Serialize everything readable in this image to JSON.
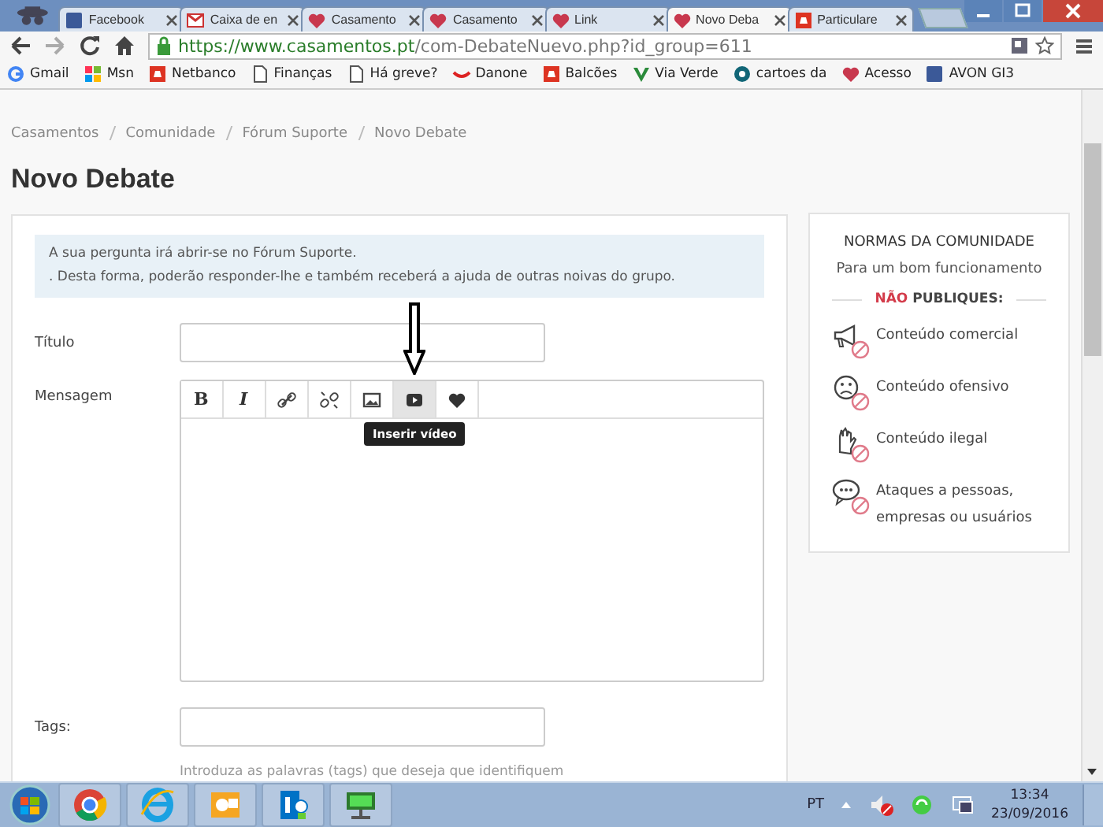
{
  "browser": {
    "tabs": [
      {
        "label": "Facebook",
        "selected": false
      },
      {
        "label": "Caixa de en",
        "selected": false
      },
      {
        "label": "Casamento",
        "selected": false
      },
      {
        "label": "Casamento",
        "selected": false
      },
      {
        "label": "Link",
        "selected": false
      },
      {
        "label": "Novo Deba",
        "selected": true
      },
      {
        "label": "Particulare",
        "selected": false
      }
    ],
    "url_host": "https://www.casamentos.pt",
    "url_path": "/com-DebateNuevo.php?id_group=611",
    "bookmarks": [
      "Gmail",
      "Msn",
      "Netbanco",
      "Finanças",
      "Há greve?",
      "Danone",
      "Balcões",
      "Via Verde",
      "cartoes da",
      "Acesso",
      "AVON GI3"
    ]
  },
  "breadcrumb": [
    "Casamentos",
    "Comunidade",
    "Fórum Suporte",
    "Novo Debate"
  ],
  "title": "Novo Debate",
  "notice": [
    "A sua pergunta irá abrir-se no Fórum Suporte.",
    ". Desta forma, poderão responder-lhe e também receberá a ajuda de outras noivas do grupo."
  ],
  "form": {
    "title_label": "Título",
    "message_label": "Mensagem",
    "tags_label": "Tags:",
    "tags_hint": "Introduza as palavras (tags) que deseja que identifiquem",
    "toolbar": [
      {
        "kind": "text",
        "label": "B",
        "selected": false
      },
      {
        "kind": "text",
        "label": "I",
        "selected": false
      },
      {
        "kind": "link",
        "selected": false
      },
      {
        "kind": "unlink",
        "selected": false
      },
      {
        "kind": "image",
        "selected": false
      },
      {
        "kind": "video",
        "selected": true
      },
      {
        "kind": "heart",
        "selected": false
      }
    ],
    "tooltip": "Inserir vídeo"
  },
  "rules": {
    "heading": "NORMAS DA COMUNIDADE",
    "subheading": "Para um bom funcionamento",
    "warning": "**NÃO** PUBLIQUES:",
    "items": [
      "Conteúdo comercial",
      "Conteúdo ofensivo",
      "Conteúdo ilegal",
      "Ataques a pessoas, empresas ou usuários"
    ]
  },
  "taskbar": {
    "language": "PT",
    "time": "13:34",
    "date": "23/09/2016"
  }
}
